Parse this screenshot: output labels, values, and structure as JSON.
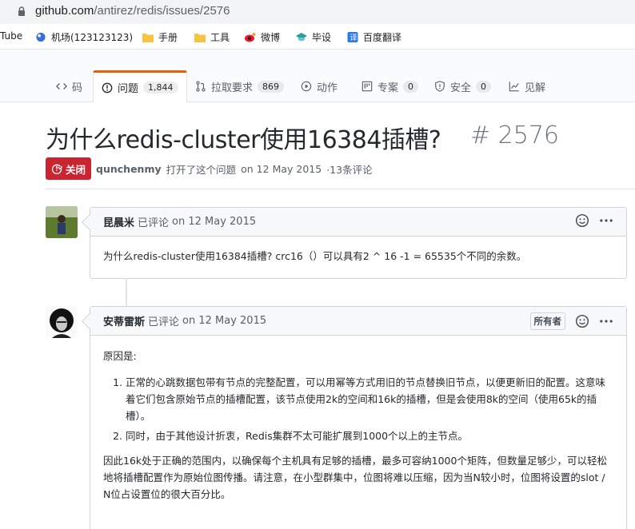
{
  "browser": {
    "url_host": "github.com",
    "url_path": "/antirez/redis/issues/2576",
    "bookmarks": [
      {
        "label": "Tube",
        "icon": "youtube-icon"
      },
      {
        "label": "机场(123123123)",
        "icon": "airport-icon"
      },
      {
        "label": "手册",
        "icon": "folder-icon"
      },
      {
        "label": "工具",
        "icon": "folder-icon"
      },
      {
        "label": "微博",
        "icon": "weibo-icon"
      },
      {
        "label": "毕设",
        "icon": "graduation-icon"
      },
      {
        "label": "百度翻译",
        "icon": "translate-icon"
      }
    ]
  },
  "repo_nav": {
    "tabs": [
      {
        "label": "码",
        "icon": "code-icon",
        "count": ""
      },
      {
        "label": "问题",
        "icon": "issue-icon",
        "count": "1,844",
        "selected": true
      },
      {
        "label": "拉取要求",
        "icon": "pull-request-icon",
        "count": "869"
      },
      {
        "label": "动作",
        "icon": "play-icon",
        "count": ""
      },
      {
        "label": "专案",
        "icon": "project-icon",
        "count": "0"
      },
      {
        "label": "安全",
        "icon": "shield-icon",
        "count": "0"
      },
      {
        "label": "见解",
        "icon": "graph-icon",
        "count": ""
      }
    ]
  },
  "issue": {
    "title": "为什么redis-cluster使用16384插槽?",
    "number": "# 2576",
    "state_label": "关闭",
    "author": "qunchenmy",
    "opened_text": "打开了这个问题",
    "opened_date": "on 12 May 2015",
    "comment_count": "·13条评论"
  },
  "comments": [
    {
      "author": "昆晨米",
      "action": "已评论",
      "date": "on 12 May 2015",
      "body": "为什么redis-cluster使用16384插槽? crc16（）可以具有2 ^ 16 -1 = 65535个不同的余数。"
    },
    {
      "author": "安蒂雷斯",
      "action": "已评论",
      "date": "on 12 May 2015",
      "badge": "所有者",
      "intro": "原因是:",
      "items": [
        "正常的心跳数据包带有节点的完整配置，可以用幂等方式用旧的节点替换旧节点，以便更新旧的配置。这意味着它们包含原始节点的插槽配置，该节点使用2k的空间和16k的插槽，但是会使用8k的空间（使用65k的插槽）。",
        "同时，由于其他设计折衷，Redis集群不太可能扩展到1000个以上的主节点。"
      ],
      "conclusion": "因此16k处于正确的范围内，以确保每个主机具有足够的插槽，最多可容纳1000个矩阵，但数量足够少，可以轻松地将插槽配置作为原始位图传播。请注意，在小型群集中，位图将难以压缩，因为当N较小时，位图将设置的slot / N位占设置位的很大百分比。"
    }
  ],
  "colors": {
    "closed": "#cb2431",
    "tab_accent": "#e36209",
    "muted": "#586069"
  }
}
